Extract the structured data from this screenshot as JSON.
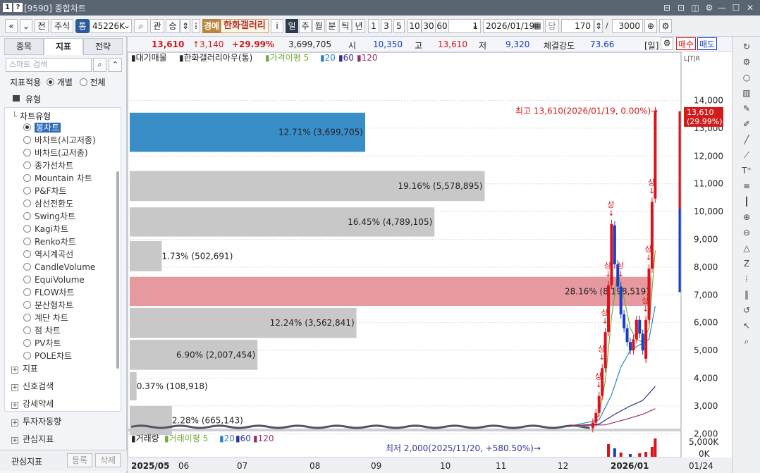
{
  "window": {
    "code": "[9590]",
    "title": "종합차트",
    "buttons": [
      "⊟",
      "⊡",
      "◫",
      "⚙",
      "—",
      "☐",
      "✕"
    ]
  },
  "toolbar": {
    "nav_prev": "«",
    "nav_down": "»",
    "before": "전",
    "market": "주식",
    "market_flag": "통",
    "code": "45226K",
    "search_btn": "⌕",
    "gwan": "관",
    "seung": "승",
    "warning": "경예",
    "stock_name": "한화갤러리",
    "info": "i",
    "periods": [
      "일",
      "주",
      "월",
      "분",
      "틱",
      "년"
    ],
    "minutes": [
      "1",
      "3",
      "5",
      "10",
      "30",
      "60"
    ],
    "unit": "1",
    "date": "2026/01/19",
    "count_label": "당",
    "count": "170",
    "total": "3000"
  },
  "left": {
    "tabs": [
      "종목",
      "지표",
      "전략"
    ],
    "active_tab": "지표",
    "search_placeholder": "스마트 검색",
    "apply_label": "지표적용",
    "apply_individual": "개별",
    "apply_all": "전체",
    "type_section": "유형",
    "chart_type_section": "차트유형",
    "chart_types": [
      "봉차트",
      "바차트(시고저종)",
      "바차트(고저종)",
      "종가선차트",
      "Mountain 차트",
      "P&F차트",
      "삼선전환도",
      "Swing차트",
      "Kagi차트",
      "Renko차트",
      "역시계곡선",
      "CandleVolume",
      "EquiVolume",
      "FLOW차트",
      "분산형차트",
      "계단 차트",
      "점 차트",
      "PV차트",
      "POLE차트"
    ],
    "groups": [
      "지표",
      "신호검색",
      "강세약세",
      "투자자동향",
      "관심지표"
    ],
    "bottom_label": "관심지표",
    "register": "등록",
    "delete": "삭제"
  },
  "quote": {
    "price": "13,610",
    "change": "↑3,140",
    "change_pct": "+29.99%",
    "volume": "3,699,705",
    "open_label": "시",
    "open": "10,350",
    "high_label": "고",
    "high": "13,610",
    "low_label": "저",
    "low": "9,320",
    "strength_label": "체결강도",
    "strength": "73.66",
    "period": "[일]",
    "buy": "매수",
    "sell": "매도"
  },
  "chart_data": {
    "type": "candlestick",
    "legend_prefix": "대기매물",
    "stock_label": "한화갤러리아우(통)",
    "ma_label": "가격이평 5",
    "ma_periods": [
      "20",
      "60",
      "120"
    ],
    "colors": {
      "ma5": "#6fae3a",
      "ma20": "#2a83c9",
      "ma60": "#2e2e99",
      "ma120": "#9b2d6b",
      "up": "#e0101a",
      "down": "#1540c8"
    },
    "y_ticks": [
      2000,
      3000,
      4000,
      5000,
      6000,
      7000,
      8000,
      9000,
      10000,
      11000,
      12000,
      13000,
      14000
    ],
    "y_tick_labels": [
      "2,000",
      "3,000",
      "4,000",
      "5,000",
      "6,000",
      "7,000",
      "8,000",
      "9,000",
      "10,000",
      "11,000",
      "12,000",
      "13,000",
      "14,000"
    ],
    "ylim": [
      1500,
      14800
    ],
    "x_labels": [
      "2025/05",
      "06",
      "07",
      "08",
      "09",
      "10",
      "11",
      "12",
      "2026/01"
    ],
    "x_axis_right": "01/24",
    "overhang_bars": [
      {
        "label": "12.71% (3,699,705)",
        "pct": 12.71,
        "lo": 12150,
        "hi": 13560,
        "highlight": "blue"
      },
      {
        "label": "19.16% (5,578,895)",
        "pct": 19.16,
        "lo": 10380,
        "hi": 11460,
        "highlight": "gray"
      },
      {
        "label": "16.45% (4,789,105)",
        "pct": 16.45,
        "lo": 9100,
        "hi": 10150,
        "highlight": "gray"
      },
      {
        "label": "1.73% (502,691)",
        "pct": 1.73,
        "lo": 7850,
        "hi": 8940,
        "highlight": "gray"
      },
      {
        "label": "28.16% (8,198,519)",
        "pct": 28.16,
        "lo": 6600,
        "hi": 7650,
        "highlight": "red"
      },
      {
        "label": "12.24% (3,562,841)",
        "pct": 12.24,
        "lo": 5450,
        "hi": 6530,
        "highlight": "gray"
      },
      {
        "label": "6.90% (2,007,454)",
        "pct": 6.9,
        "lo": 4300,
        "hi": 5380,
        "highlight": "gray"
      },
      {
        "label": "0.37% (108,918)",
        "pct": 0.37,
        "lo": 3200,
        "hi": 4220,
        "highlight": "gray"
      },
      {
        "label": "2.28% (665,143)",
        "pct": 2.28,
        "lo": 1950,
        "hi": 3000,
        "highlight": "gray"
      }
    ],
    "candles": [
      {
        "i": 148,
        "o": 2200,
        "c": 2400
      },
      {
        "i": 149,
        "o": 2400,
        "c": 2750
      },
      {
        "i": 150,
        "o": 2750,
        "c": 3360
      },
      {
        "i": 151,
        "o": 3360,
        "c": 4360
      },
      {
        "i": 152,
        "o": 4360,
        "c": 5660
      },
      {
        "i": 153,
        "o": 5660,
        "c": 7350
      },
      {
        "i": 154,
        "o": 7350,
        "c": 9550
      },
      {
        "i": 155,
        "o": 9500,
        "c": 8100
      },
      {
        "i": 156,
        "o": 8100,
        "c": 7300
      },
      {
        "i": 157,
        "o": 7300,
        "c": 6300
      },
      {
        "i": 158,
        "o": 6300,
        "c": 5800
      },
      {
        "i": 159,
        "o": 5800,
        "c": 5300
      },
      {
        "i": 160,
        "o": 5300,
        "c": 5000
      },
      {
        "i": 161,
        "o": 5000,
        "c": 5400
      },
      {
        "i": 162,
        "o": 5400,
        "c": 6100
      },
      {
        "i": 163,
        "o": 6100,
        "c": 5600
      },
      {
        "i": 164,
        "o": 5600,
        "c": 5000
      },
      {
        "i": 165,
        "o": 4700,
        "c": 6100
      },
      {
        "i": 166,
        "o": 6100,
        "c": 7950
      },
      {
        "i": 167,
        "o": 7950,
        "c": 10350
      },
      {
        "i": 168,
        "o": 10470,
        "c": 13610
      }
    ],
    "limit_up_label": "상",
    "annotation_high": "최고 13,610(2026/01/19, 0.00%)",
    "annotation_low": "최저 2,000(2025/11/20, +580.50%)",
    "last_price": "13,610",
    "last_pct": "(29.99%)",
    "volume_panel": {
      "label": "거래량",
      "ma_label": "거래이평 5",
      "ma_periods": [
        "20",
        "60",
        "120"
      ],
      "y_ticks": [
        "5,000K",
        "0K"
      ]
    }
  },
  "rightbar": {
    "icons": [
      "refresh-icon",
      "gear-icon",
      "circle-icon",
      "bar-chart-icon",
      "pen-icon",
      "pencil-icon",
      "line-icon",
      "auto-line-icon",
      "text-icon",
      "fib-icon",
      "candle-icon",
      "zoom-in-icon",
      "zoom-out-icon",
      "tri-icon",
      "N-icon",
      "wave-icon",
      "lines-icon",
      "undo-icon",
      "arrow-icon",
      "search-icon"
    ]
  }
}
